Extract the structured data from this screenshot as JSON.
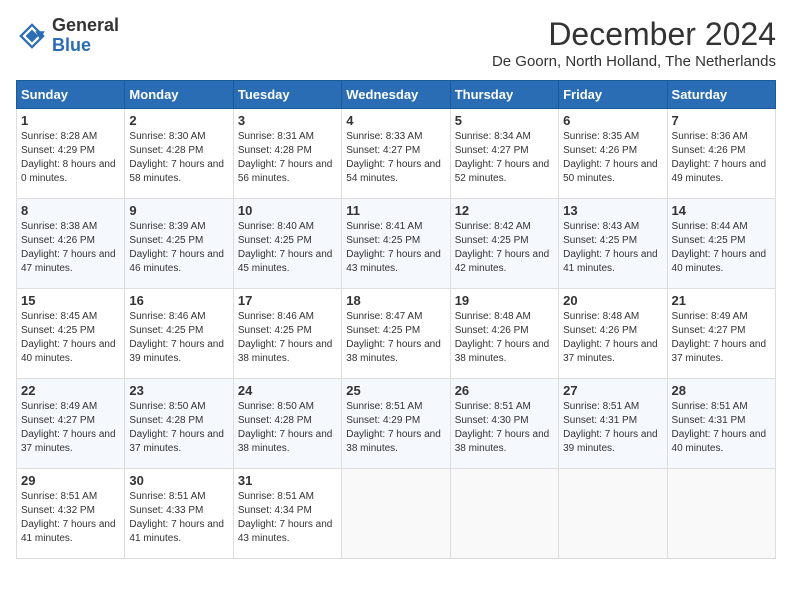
{
  "logo": {
    "general": "General",
    "blue": "Blue"
  },
  "title": "December 2024",
  "location": "De Goorn, North Holland, The Netherlands",
  "days_of_week": [
    "Sunday",
    "Monday",
    "Tuesday",
    "Wednesday",
    "Thursday",
    "Friday",
    "Saturday"
  ],
  "weeks": [
    [
      {
        "day": 1,
        "sunrise": "8:28 AM",
        "sunset": "4:29 PM",
        "daylight": "8 hours and 0 minutes."
      },
      {
        "day": 2,
        "sunrise": "8:30 AM",
        "sunset": "4:28 PM",
        "daylight": "7 hours and 58 minutes."
      },
      {
        "day": 3,
        "sunrise": "8:31 AM",
        "sunset": "4:28 PM",
        "daylight": "7 hours and 56 minutes."
      },
      {
        "day": 4,
        "sunrise": "8:33 AM",
        "sunset": "4:27 PM",
        "daylight": "7 hours and 54 minutes."
      },
      {
        "day": 5,
        "sunrise": "8:34 AM",
        "sunset": "4:27 PM",
        "daylight": "7 hours and 52 minutes."
      },
      {
        "day": 6,
        "sunrise": "8:35 AM",
        "sunset": "4:26 PM",
        "daylight": "7 hours and 50 minutes."
      },
      {
        "day": 7,
        "sunrise": "8:36 AM",
        "sunset": "4:26 PM",
        "daylight": "7 hours and 49 minutes."
      }
    ],
    [
      {
        "day": 8,
        "sunrise": "8:38 AM",
        "sunset": "4:26 PM",
        "daylight": "7 hours and 47 minutes."
      },
      {
        "day": 9,
        "sunrise": "8:39 AM",
        "sunset": "4:25 PM",
        "daylight": "7 hours and 46 minutes."
      },
      {
        "day": 10,
        "sunrise": "8:40 AM",
        "sunset": "4:25 PM",
        "daylight": "7 hours and 45 minutes."
      },
      {
        "day": 11,
        "sunrise": "8:41 AM",
        "sunset": "4:25 PM",
        "daylight": "7 hours and 43 minutes."
      },
      {
        "day": 12,
        "sunrise": "8:42 AM",
        "sunset": "4:25 PM",
        "daylight": "7 hours and 42 minutes."
      },
      {
        "day": 13,
        "sunrise": "8:43 AM",
        "sunset": "4:25 PM",
        "daylight": "7 hours and 41 minutes."
      },
      {
        "day": 14,
        "sunrise": "8:44 AM",
        "sunset": "4:25 PM",
        "daylight": "7 hours and 40 minutes."
      }
    ],
    [
      {
        "day": 15,
        "sunrise": "8:45 AM",
        "sunset": "4:25 PM",
        "daylight": "7 hours and 40 minutes."
      },
      {
        "day": 16,
        "sunrise": "8:46 AM",
        "sunset": "4:25 PM",
        "daylight": "7 hours and 39 minutes."
      },
      {
        "day": 17,
        "sunrise": "8:46 AM",
        "sunset": "4:25 PM",
        "daylight": "7 hours and 38 minutes."
      },
      {
        "day": 18,
        "sunrise": "8:47 AM",
        "sunset": "4:25 PM",
        "daylight": "7 hours and 38 minutes."
      },
      {
        "day": 19,
        "sunrise": "8:48 AM",
        "sunset": "4:26 PM",
        "daylight": "7 hours and 38 minutes."
      },
      {
        "day": 20,
        "sunrise": "8:48 AM",
        "sunset": "4:26 PM",
        "daylight": "7 hours and 37 minutes."
      },
      {
        "day": 21,
        "sunrise": "8:49 AM",
        "sunset": "4:27 PM",
        "daylight": "7 hours and 37 minutes."
      }
    ],
    [
      {
        "day": 22,
        "sunrise": "8:49 AM",
        "sunset": "4:27 PM",
        "daylight": "7 hours and 37 minutes."
      },
      {
        "day": 23,
        "sunrise": "8:50 AM",
        "sunset": "4:28 PM",
        "daylight": "7 hours and 37 minutes."
      },
      {
        "day": 24,
        "sunrise": "8:50 AM",
        "sunset": "4:28 PM",
        "daylight": "7 hours and 38 minutes."
      },
      {
        "day": 25,
        "sunrise": "8:51 AM",
        "sunset": "4:29 PM",
        "daylight": "7 hours and 38 minutes."
      },
      {
        "day": 26,
        "sunrise": "8:51 AM",
        "sunset": "4:30 PM",
        "daylight": "7 hours and 38 minutes."
      },
      {
        "day": 27,
        "sunrise": "8:51 AM",
        "sunset": "4:31 PM",
        "daylight": "7 hours and 39 minutes."
      },
      {
        "day": 28,
        "sunrise": "8:51 AM",
        "sunset": "4:31 PM",
        "daylight": "7 hours and 40 minutes."
      }
    ],
    [
      {
        "day": 29,
        "sunrise": "8:51 AM",
        "sunset": "4:32 PM",
        "daylight": "7 hours and 41 minutes."
      },
      {
        "day": 30,
        "sunrise": "8:51 AM",
        "sunset": "4:33 PM",
        "daylight": "7 hours and 41 minutes."
      },
      {
        "day": 31,
        "sunrise": "8:51 AM",
        "sunset": "4:34 PM",
        "daylight": "7 hours and 43 minutes."
      },
      null,
      null,
      null,
      null
    ]
  ]
}
